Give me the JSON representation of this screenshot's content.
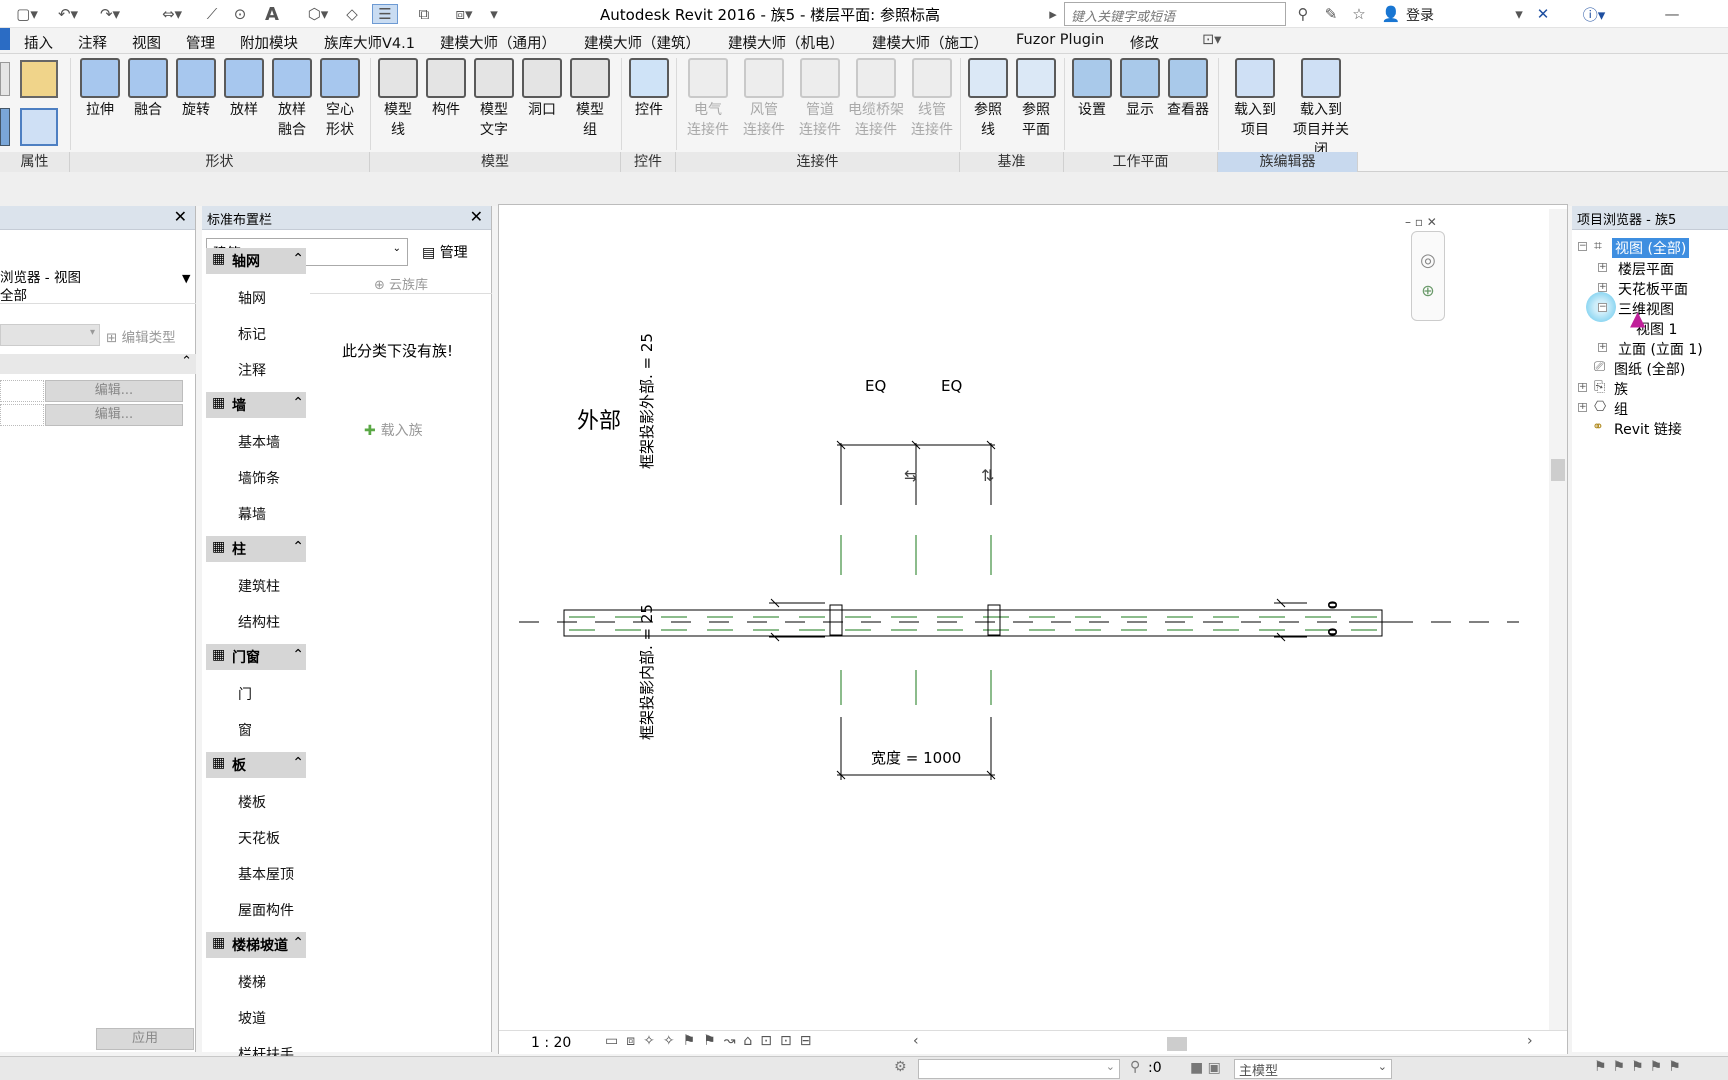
{
  "window": {
    "title": "Autodesk Revit 2016 -     族5 - 楼层平面: 参照标高",
    "search_placeholder": "键入关键字或短语",
    "login": "登录"
  },
  "menu": [
    "插入",
    "注释",
    "视图",
    "管理",
    "附加模块",
    "族库大师V4.1",
    "建模大师（通用）",
    "建模大师（建筑）",
    "建模大师（机电）",
    "建模大师（施工）",
    "Fuzor Plugin",
    "修改"
  ],
  "ribbon": {
    "shape": [
      {
        "l1": "拉伸",
        "l2": ""
      },
      {
        "l1": "融合",
        "l2": ""
      },
      {
        "l1": "旋转",
        "l2": ""
      },
      {
        "l1": "放样",
        "l2": ""
      },
      {
        "l1": "放样",
        "l2": "融合"
      },
      {
        "l1": "空心",
        "l2": "形状"
      }
    ],
    "model": [
      {
        "l1": "模型",
        "l2": "线"
      },
      {
        "l1": "构件",
        "l2": ""
      },
      {
        "l1": "模型",
        "l2": "文字"
      },
      {
        "l1": "洞口",
        "l2": ""
      },
      {
        "l1": "模型",
        "l2": "组"
      }
    ],
    "control": [
      {
        "l1": "控件",
        "l2": ""
      }
    ],
    "connector": [
      {
        "l1": "电气",
        "l2": "连接件"
      },
      {
        "l1": "风管",
        "l2": "连接件"
      },
      {
        "l1": "管道",
        "l2": "连接件"
      },
      {
        "l1": "电缆桥架",
        "l2": "连接件"
      },
      {
        "l1": "线管",
        "l2": "连接件"
      }
    ],
    "datum": [
      {
        "l1": "参照",
        "l2": "线"
      },
      {
        "l1": "参照",
        "l2": "平面"
      }
    ],
    "workplane": [
      {
        "l1": "设置",
        "l2": ""
      },
      {
        "l1": "显示",
        "l2": ""
      },
      {
        "l1": "查看器",
        "l2": ""
      }
    ],
    "editor": [
      {
        "l1": "载入到",
        "l2": "项目"
      },
      {
        "l1": "载入到",
        "l2": "项目并关闭"
      }
    ],
    "groups": {
      "props": "属性",
      "shape": "形状",
      "model": "模型",
      "control": "控件",
      "connector": "连接件",
      "datum": "基准",
      "workplane": "工作平面",
      "editor": "族编辑器"
    }
  },
  "left": {
    "line1": "浏览器 - 视图",
    "line2": "全部",
    "edit_type": "编辑类型",
    "edit1": "编辑...",
    "edit2": "编辑...",
    "apply": "应用"
  },
  "mid": {
    "title": "标准布置栏",
    "dropdown": "建筑",
    "manage": "管理",
    "cloud": "云族库",
    "empty": "此分类下没有族!",
    "load": "载入族",
    "cats": [
      {
        "h": "轴网",
        "items": [
          "轴网",
          "标记",
          "注释"
        ]
      },
      {
        "h": "墙",
        "items": [
          "基本墙",
          "墙饰条",
          "幕墙"
        ]
      },
      {
        "h": "柱",
        "items": [
          "建筑柱",
          "结构柱"
        ]
      },
      {
        "h": "门窗",
        "items": [
          "门",
          "窗"
        ]
      },
      {
        "h": "板",
        "items": [
          "楼板",
          "天花板",
          "基本屋顶",
          "屋面构件"
        ]
      },
      {
        "h": "楼梯坡道",
        "items": [
          "楼梯",
          "坡道",
          "栏杆扶手"
        ]
      }
    ]
  },
  "canvas": {
    "outer": "外部",
    "eq1": "EQ",
    "eq2": "EQ",
    "dim_out": "框架投影外部. = 25",
    "dim_in": "框架投影内部. = 25",
    "width": "宽度 = 1000",
    "zero1": "0",
    "zero2": "0",
    "scale": "1 : 20"
  },
  "browser": {
    "title": "项目浏览器 - 族5",
    "views": "视图 (全部)",
    "floor": "楼层平面",
    "ceiling": "天花板平面",
    "3d": "三维视图",
    "view1": "视图 1",
    "elev": "立面 (立面 1)",
    "sheets": "图纸 (全部)",
    "family": "族",
    "group": "组",
    "links": "Revit 链接"
  },
  "status": {
    "count": ":0",
    "model": "主模型"
  }
}
